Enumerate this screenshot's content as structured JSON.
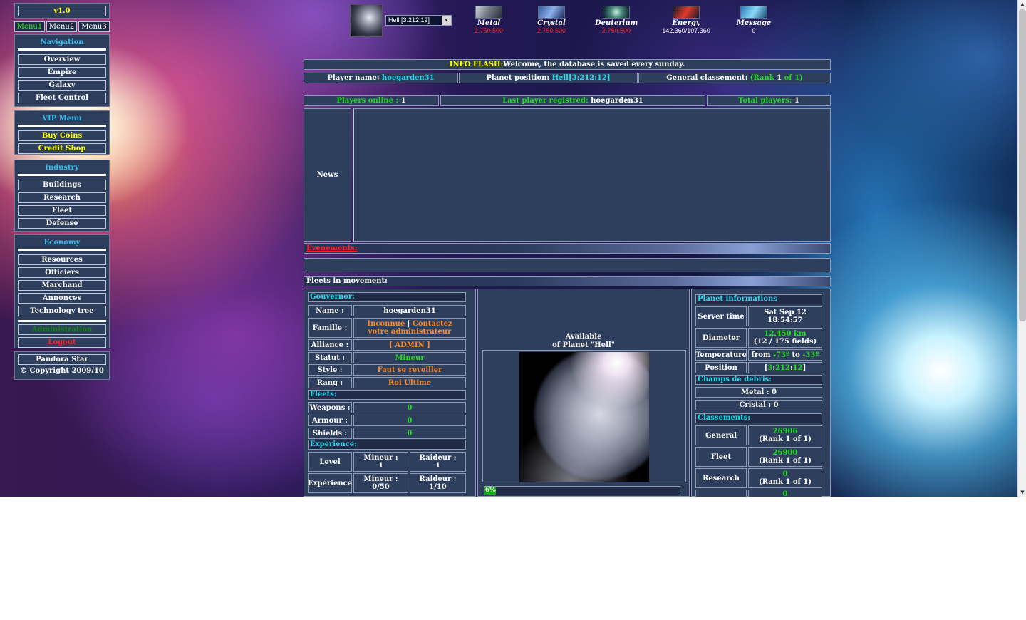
{
  "version": "v1.0",
  "menu_tabs": [
    "Menu1",
    "Menu2",
    "Menu3"
  ],
  "nav": {
    "navigation": {
      "title": "Navigation",
      "items": [
        "Overview",
        "Empire",
        "Galaxy",
        "Fleet Control"
      ]
    },
    "vip": {
      "title": "VIP Menu",
      "items": [
        "Buy Coins",
        "Credit Shop"
      ]
    },
    "industry": {
      "title": "Industry",
      "items": [
        "Buildings",
        "Research",
        "Fleet",
        "Defense"
      ]
    },
    "economy": {
      "title": "Economy",
      "items": [
        "Resources",
        "Officiers",
        "Marchand",
        "Annonces",
        "Technology tree"
      ]
    },
    "admin_label": "Administration",
    "logout_label": "Logout"
  },
  "footer": {
    "game_name": "Pandora Star",
    "copyright": "© Copyright 2009/10"
  },
  "planet_select": {
    "value": "Hell [3:212:12]"
  },
  "resources": {
    "metal": {
      "name": "Metal",
      "value": "2.750.500",
      "color": "#ff2222"
    },
    "crystal": {
      "name": "Crystal",
      "value": "2.750.500",
      "color": "#ff2222"
    },
    "deuterium": {
      "name": "Deuterium",
      "value": "2.750.500",
      "color": "#ff2222"
    },
    "energy": {
      "name": "Energy",
      "value": "142.360/197.360",
      "color": "#ffffff"
    },
    "message": {
      "name": "Message",
      "value": "0",
      "color": "#ffffff"
    }
  },
  "info_flash": {
    "label": "INFO FLASH:",
    "text": "Welcome, the database is saved every sunday."
  },
  "player_bar": {
    "name_label": "Player name:",
    "name": "hoegarden31",
    "position_label": "Planet position:",
    "position_planet": "Hell",
    "position_coords": "[3:212:12]",
    "rank_label": "General classement:",
    "rank_open": "(Rank",
    "rank_num": "1",
    "rank_close": "of 1)"
  },
  "stats_bar": {
    "online_label": "Players online :",
    "online": "1",
    "last_label": "Last player registred:",
    "last": "hoegarden31",
    "total_label": "Total players:",
    "total": "1"
  },
  "news_label": "News",
  "events_label": "Evenements:",
  "fleets_label": "Fleets in movement:",
  "governor": {
    "title": "Gouvernor:",
    "rows": [
      {
        "k": "Name :",
        "v": "hoegarden31"
      },
      {
        "k": "Famille :",
        "v1": "Inconnue",
        "sep": " | ",
        "v2": "Contactez votre administrateur"
      },
      {
        "k": "Alliance :",
        "v": "[ ADMIN ]"
      },
      {
        "k": "Statut :",
        "v": "Mineur"
      },
      {
        "k": "Style :",
        "v": "Faut se reveiller"
      },
      {
        "k": "Rang :",
        "v": "Roi Ultime"
      }
    ],
    "fleets_title": "Fleets:",
    "fleets": [
      {
        "k": "Weapons :",
        "v": "0"
      },
      {
        "k": "Armour :",
        "v": "0"
      },
      {
        "k": "Shields :",
        "v": "0"
      }
    ],
    "exp_title": "Experience:",
    "exp": [
      {
        "k": "Level",
        "a1": "Mineur :",
        "a2": "1",
        "b1": "Raideur :",
        "b2": "1"
      },
      {
        "k": "Expérience",
        "a1": "Mineur :",
        "a2": "0/50",
        "b1": "Raideur :",
        "b2": "1/10"
      }
    ]
  },
  "planet_view": {
    "line1": "Available",
    "line2": "of Planet \"Hell\"",
    "progress": 6,
    "progress_label": "6%"
  },
  "planet_info": {
    "title": "Planet informations",
    "server_time_label": "Server time",
    "server_time_1": "Sat Sep 12",
    "server_time_2": "18:54:57",
    "diameter_label": "Diameter",
    "diameter": "12.450 km",
    "fields": "(12 / 175 fields)",
    "temp_label": "Temperature",
    "temp_from": "from",
    "temp_min": "-73º",
    "temp_to": "to",
    "temp_max": "-33º",
    "position_label": "Position",
    "pos_open": "[",
    "pos_g": "3",
    "pos_s1": ":",
    "pos_s": "212",
    "pos_s2": ":",
    "pos_p": "12",
    "pos_close": "]",
    "debris_title": "Champs de debris:",
    "debris_metal": "Metal : 0",
    "debris_crystal": "Cristal : 0",
    "class_title": "Classements:",
    "classes": [
      {
        "k": "General",
        "v": "26906",
        "r": "(Rank 1 of 1)"
      },
      {
        "k": "Fleet",
        "v": "26900",
        "r": "(Rank 1 of 1)"
      },
      {
        "k": "Research",
        "v": "0",
        "r": "(Rank 1 of 1)"
      },
      {
        "k": "",
        "v": "0",
        "r": ""
      }
    ]
  }
}
